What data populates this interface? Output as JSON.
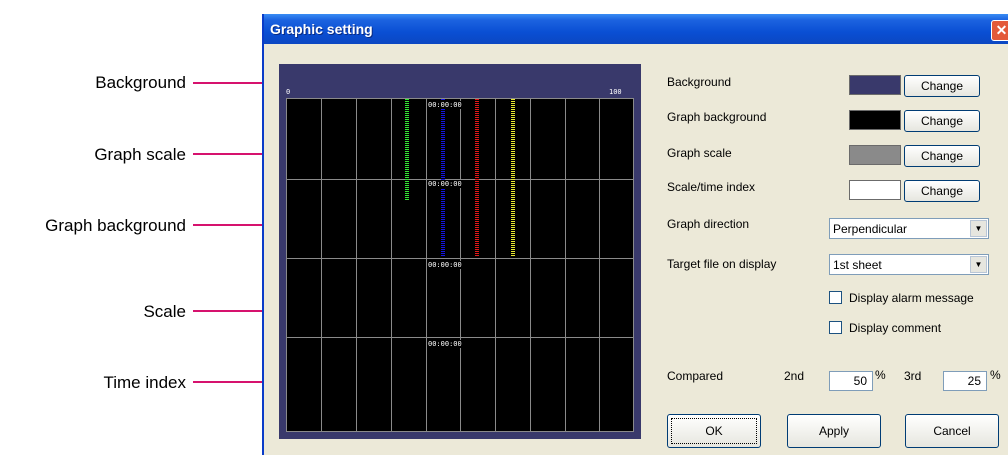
{
  "callouts": {
    "background": "Background",
    "graph_scale": "Graph scale",
    "graph_background": "Graph background",
    "scale": "Scale",
    "time_index": "Time index"
  },
  "dialog": {
    "title": "Graphic setting",
    "close_glyph": "✕"
  },
  "preview": {
    "scale_min": "0",
    "scale_max": "100",
    "time_indexes": [
      "00:00:00",
      "00:00:00",
      "00:00:00",
      "00:00:00"
    ],
    "trace_colors": [
      "#33e633",
      "#1515e0",
      "#e01818",
      "#e8e830"
    ],
    "colors": {
      "background": "#39396b",
      "graph_background": "#000000",
      "graph_scale": "#8a8a8a",
      "scale_time_index": "#ffffff"
    }
  },
  "settings": {
    "background_label": "Background",
    "graph_background_label": "Graph background",
    "graph_scale_label": "Graph scale",
    "scale_time_index_label": "Scale/time index",
    "change_label": "Change",
    "graph_direction_label": "Graph direction",
    "graph_direction_value": "Perpendicular",
    "target_file_label": "Target file on display",
    "target_file_value": "1st sheet",
    "display_alarm_message_label": "Display alarm message",
    "display_comment_label": "Display comment",
    "compared_label": "Compared",
    "second_label": "2nd",
    "second_value": "50",
    "third_label": "3rd",
    "third_value": "25",
    "percent": "%",
    "swatch_colors": {
      "background": "#39396b",
      "graph_background": "#000000",
      "graph_scale": "#8a8a8a",
      "scale_time_index": "#ffffff"
    }
  },
  "buttons": {
    "ok": "OK",
    "apply": "Apply",
    "cancel": "Cancel"
  }
}
